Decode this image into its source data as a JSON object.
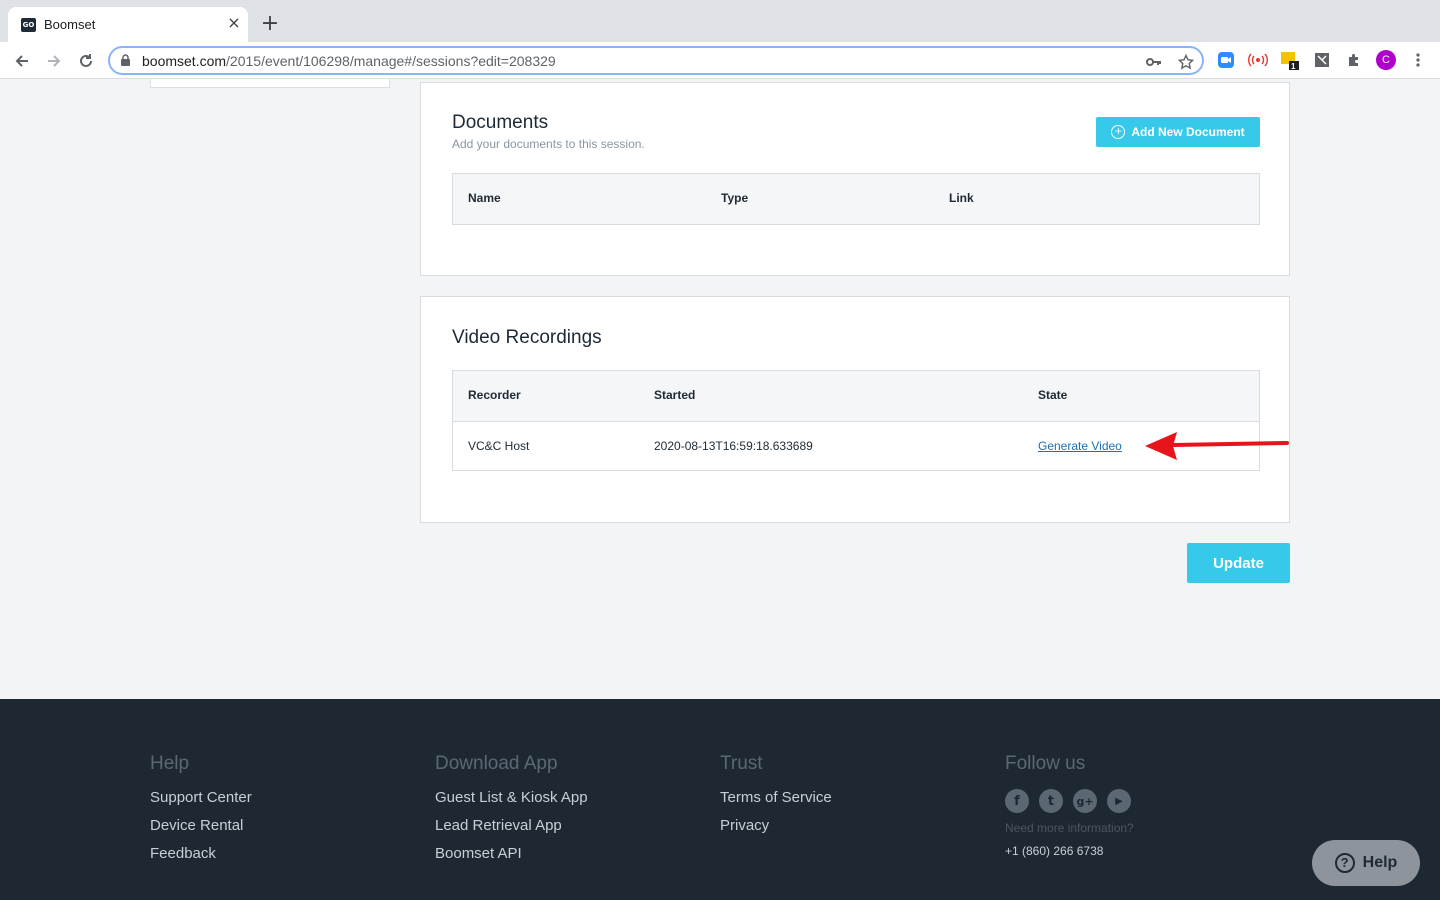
{
  "browser": {
    "tab_title": "Boomset",
    "favicon_text": "GO",
    "url_host": "boomset.com",
    "url_path": "/2015/event/106298/manage#/sessions?edit=208329",
    "avatar_letter": "C",
    "ext_badge": "1"
  },
  "documents": {
    "title": "Documents",
    "subtitle": "Add your documents to this session.",
    "add_button": "Add New Document",
    "columns": [
      "Name",
      "Type",
      "Link"
    ]
  },
  "video": {
    "title": "Video Recordings",
    "columns": [
      "Recorder",
      "Started",
      "State"
    ],
    "rows": [
      {
        "recorder": "VC&C Host",
        "started": "2020-08-13T16:59:18.633689",
        "state": "Generate Video"
      }
    ]
  },
  "update_button": "Update",
  "footer": {
    "help": {
      "heading": "Help",
      "links": [
        "Support Center",
        "Device Rental",
        "Feedback"
      ]
    },
    "download": {
      "heading": "Download App",
      "links": [
        "Guest List & Kiosk App",
        "Lead Retrieval App",
        "Boomset API"
      ]
    },
    "trust": {
      "heading": "Trust",
      "links": [
        "Terms of Service",
        "Privacy"
      ]
    },
    "follow": {
      "heading": "Follow us",
      "need_info": "Need more information?",
      "phone": "+1 (860) 266 6738",
      "social": [
        "f",
        "t",
        "g+",
        "▶"
      ]
    }
  },
  "help_widget": {
    "label": "Help"
  },
  "colors": {
    "accent": "#36c9ea",
    "footer_bg": "#1e2833",
    "link": "#1f6fb0",
    "arrow": "#e8141b"
  }
}
